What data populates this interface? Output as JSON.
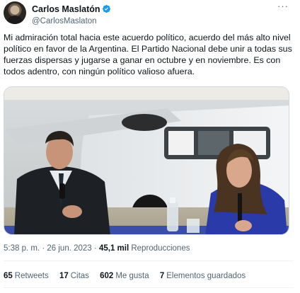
{
  "author": {
    "display_name": "Carlos Maslatón",
    "handle": "@CarlosMaslaton",
    "verified": true
  },
  "tweet": {
    "text": "Mi admiración total hacia este acuerdo político, acuerdo del más alto nivel político en favor de la Argentina. El Partido Nacional debe unir a todas sus fuerzas dispersas y jugarse a ganar en octubre y en noviembre. Es con todos adentro, con ningún político valioso afuera.",
    "time": "5:38 p. m.",
    "separator": "·",
    "date": "26 jun. 2023",
    "views_count": "45,1 mil",
    "views_label": "Reproducciones"
  },
  "stats": [
    {
      "count": "65",
      "label": "Retweets"
    },
    {
      "count": "17",
      "label": "Citas"
    },
    {
      "count": "602",
      "label": "Me gusta"
    },
    {
      "count": "7",
      "label": "Elementos guardados"
    }
  ],
  "colors": {
    "verified": "#1d9bf0",
    "secondary_text": "#536471",
    "primary_text": "#0f1419"
  },
  "icons": {
    "more": "more-dots-icon",
    "verified": "verified-badge-icon"
  }
}
